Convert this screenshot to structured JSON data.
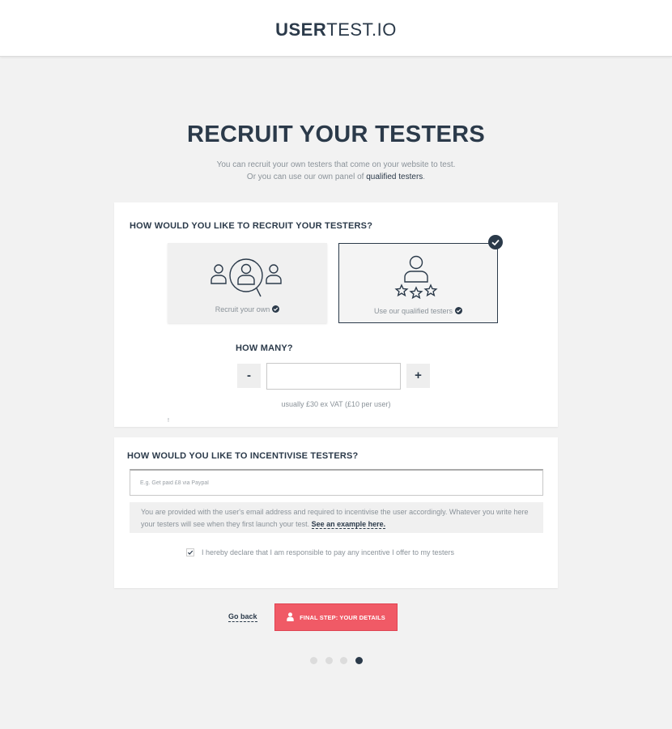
{
  "header": {
    "logo_bold": "USER",
    "logo_light": "TEST.IO"
  },
  "page": {
    "title": "RECRUIT YOUR TESTERS",
    "subtitle_line1": "You can recruit your own testers that come on your website to test.",
    "subtitle_line2_prefix": "Or you can use our own panel of ",
    "subtitle_link": "qualified testers",
    "subtitle_line2_suffix": "."
  },
  "recruit": {
    "heading": "HOW WOULD YOU LIKE TO RECRUIT YOUR TESTERS?",
    "option_own_label": "Recruit your own",
    "option_qualified_label": "Use our qualified testers",
    "selected_option": "qualified",
    "how_many_heading": "HOW MANY?",
    "minus_label": "-",
    "plus_label": "+",
    "quantity_value": "",
    "price_note": "usually £30 ex VAT (£10 per user)",
    "tiny_mark": "!"
  },
  "incentive": {
    "heading": "HOW WOULD YOU LIKE TO INCENTIVISE TESTERS?",
    "placeholder": "E.g. Get paid £8 via Paypal",
    "value": "",
    "info_text": "You are provided with the user's email address and required to incentivise the user accordingly. Whatever you write here your testers will see when they first launch your test. ",
    "info_link": "See an example here.",
    "declare_label": "I hereby declare that I am responsible to pay any incentive I offer to my testers",
    "declare_checked": true
  },
  "footer": {
    "go_back": "Go back",
    "final_button": "FINAL STEP: YOUR DETAILS",
    "progress_steps": 4,
    "progress_current": 4
  },
  "colors": {
    "primary": "#2b3a4a",
    "accent": "#f05a66",
    "background": "#f2f2f2",
    "muted_text": "#8a9299"
  }
}
